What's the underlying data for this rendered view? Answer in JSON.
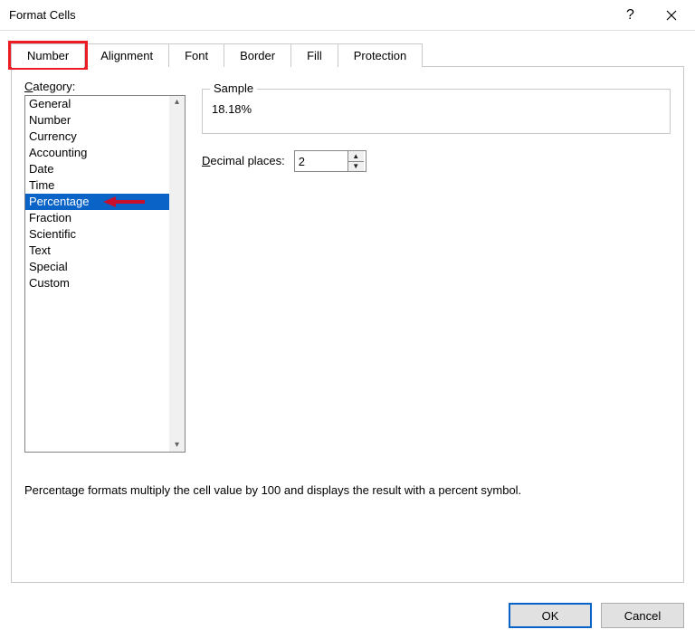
{
  "title": "Format Cells",
  "tabs": [
    {
      "label": "Number"
    },
    {
      "label": "Alignment"
    },
    {
      "label": "Font"
    },
    {
      "label": "Border"
    },
    {
      "label": "Fill"
    },
    {
      "label": "Protection"
    }
  ],
  "category_label_prefix": "C",
  "category_label_rest": "ategory:",
  "categories": [
    "General",
    "Number",
    "Currency",
    "Accounting",
    "Date",
    "Time",
    "Percentage",
    "Fraction",
    "Scientific",
    "Text",
    "Special",
    "Custom"
  ],
  "selected_category_index": 6,
  "sample_label": "Sample",
  "sample_value": "18.18%",
  "decimal_label_prefix": "D",
  "decimal_label_rest": "ecimal places:",
  "decimal_value": "2",
  "description": "Percentage formats multiply the cell value by 100 and displays the result with a percent symbol.",
  "ok_label": "OK",
  "cancel_label": "Cancel"
}
